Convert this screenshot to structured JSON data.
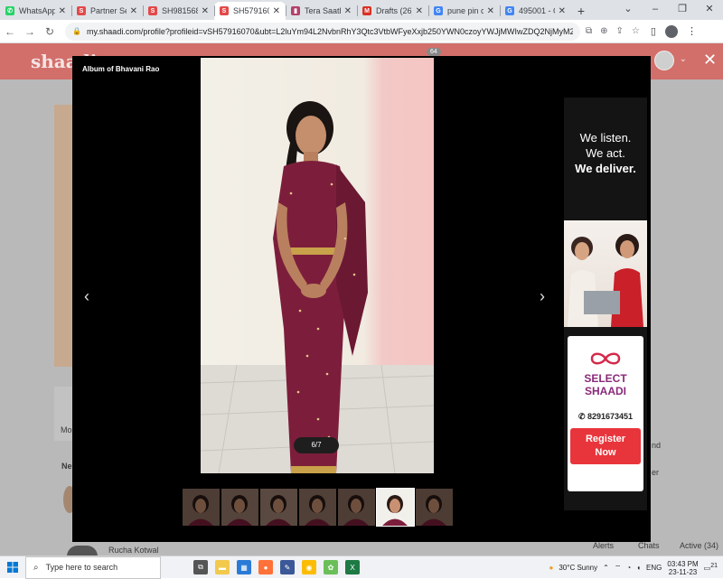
{
  "browser": {
    "tabs": [
      {
        "title": "WhatsApp",
        "favicon_color": "#25d366",
        "glyph": "✆"
      },
      {
        "title": "Partner Se",
        "favicon_color": "#e24a4a",
        "glyph": "S"
      },
      {
        "title": "SH981568",
        "favicon_color": "#e24a4a",
        "glyph": "S"
      },
      {
        "title": "SH579160",
        "favicon_color": "#e24a4a",
        "glyph": "S",
        "active": true
      },
      {
        "title": "Tera Saath",
        "favicon_color": "#b3416a",
        "glyph": "▮"
      },
      {
        "title": "Drafts (26)",
        "favicon_color": "#d93025",
        "glyph": "M"
      },
      {
        "title": "pune pin c",
        "favicon_color": "#4285f4",
        "glyph": "G"
      },
      {
        "title": "495001 - C",
        "favicon_color": "#4285f4",
        "glyph": "G"
      }
    ],
    "new_tab": "+",
    "url": "my.shaadi.com/profile?profileid=vSH57916070&ubt=L2luYm94L2NvbnRhY3Qtc3VtbWFyeXxjb250YWN0czoyYWJjMWIwZDQ2NjMyM2U2MDQy..."
  },
  "page": {
    "logo": "shaadi",
    "notif_count": "64",
    "bg_texts": [
      "Mo",
      "Ne",
      "Rucha Kotwal",
      "Alerts",
      "Chats",
      "Active (34)",
      "nd",
      "er"
    ]
  },
  "lightbox": {
    "title": "Album of Bhavani Rao",
    "counter": "6/7",
    "prev": "‹",
    "next": "›",
    "close": "✕",
    "thumbnail_count": 7,
    "active_index": 5
  },
  "ad": {
    "line1": "We listen.",
    "line2": "We act.",
    "line3": "We deliver.",
    "brand_line1": "SELECT",
    "brand_line2": "SHAADI",
    "phone": "8291673451",
    "cta_line1": "Register",
    "cta_line2": "Now"
  },
  "taskbar": {
    "search_placeholder": "Type here to search",
    "weather": "30°C  Sunny",
    "language": "ENG",
    "time": "03:43 PM",
    "date": "23-11-23",
    "notifications": "21"
  }
}
